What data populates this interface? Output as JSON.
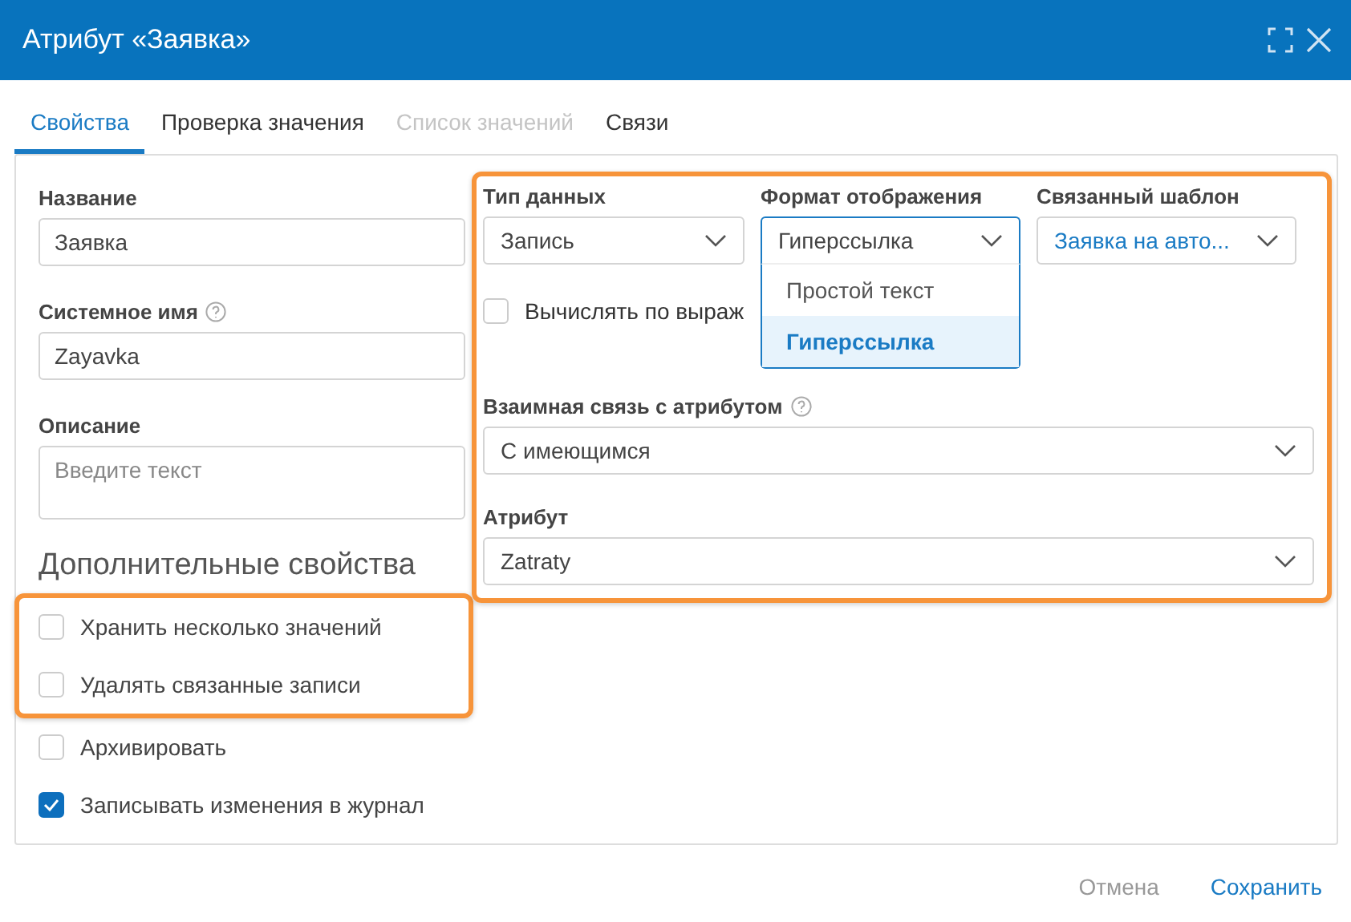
{
  "window": {
    "title": "Атрибут «Заявка»"
  },
  "tabs": [
    {
      "label": "Свойства",
      "selected": true,
      "disabled": false
    },
    {
      "label": "Проверка значения",
      "selected": false,
      "disabled": false
    },
    {
      "label": "Список значений",
      "selected": false,
      "disabled": true
    },
    {
      "label": "Связи",
      "selected": false,
      "disabled": false
    }
  ],
  "fields": [
    {
      "kind": "input",
      "label": "Название",
      "value": "Заявка",
      "help": false
    },
    {
      "kind": "input",
      "label": "Системное имя",
      "value": "Zayavka",
      "help": true
    },
    {
      "kind": "textarea",
      "label": "Описание",
      "placeholder": "Введите текст",
      "help": false
    }
  ],
  "section_title": "Дополнительные свойства",
  "options": [
    {
      "label": "Хранить несколько значений",
      "checked": false,
      "highlighted": true
    },
    {
      "label": "Удалять связанные записи",
      "checked": false,
      "highlighted": true
    },
    {
      "label": "Архивировать",
      "checked": false,
      "highlighted": false
    },
    {
      "label": "Записывать изменения в журнал",
      "checked": true,
      "highlighted": false
    }
  ],
  "top_selects": [
    {
      "label": "Тип данных",
      "value": "Запись",
      "link": false,
      "open": false
    },
    {
      "label": "Формат отображения",
      "value": "Гиперссылка",
      "link": false,
      "open": true
    },
    {
      "label": "Связанный шаблон",
      "value": "Заявка на авто...",
      "link": true,
      "open": false
    }
  ],
  "dropdown_options": [
    {
      "label": "Простой текст",
      "selected": false
    },
    {
      "label": "Гиперссылка",
      "selected": true
    }
  ],
  "compute": {
    "label": "Вычислять по выраж",
    "checked": false
  },
  "wide_selects": [
    {
      "label": "Взаимная связь с атрибутом",
      "value": "С имеющимся",
      "help": true
    },
    {
      "label": "Атрибут",
      "value": "Zatraty",
      "help": false
    }
  ],
  "buttons": [
    {
      "label": "Отмена",
      "kind": "secondary"
    },
    {
      "label": "Сохранить",
      "kind": "primary"
    }
  ]
}
